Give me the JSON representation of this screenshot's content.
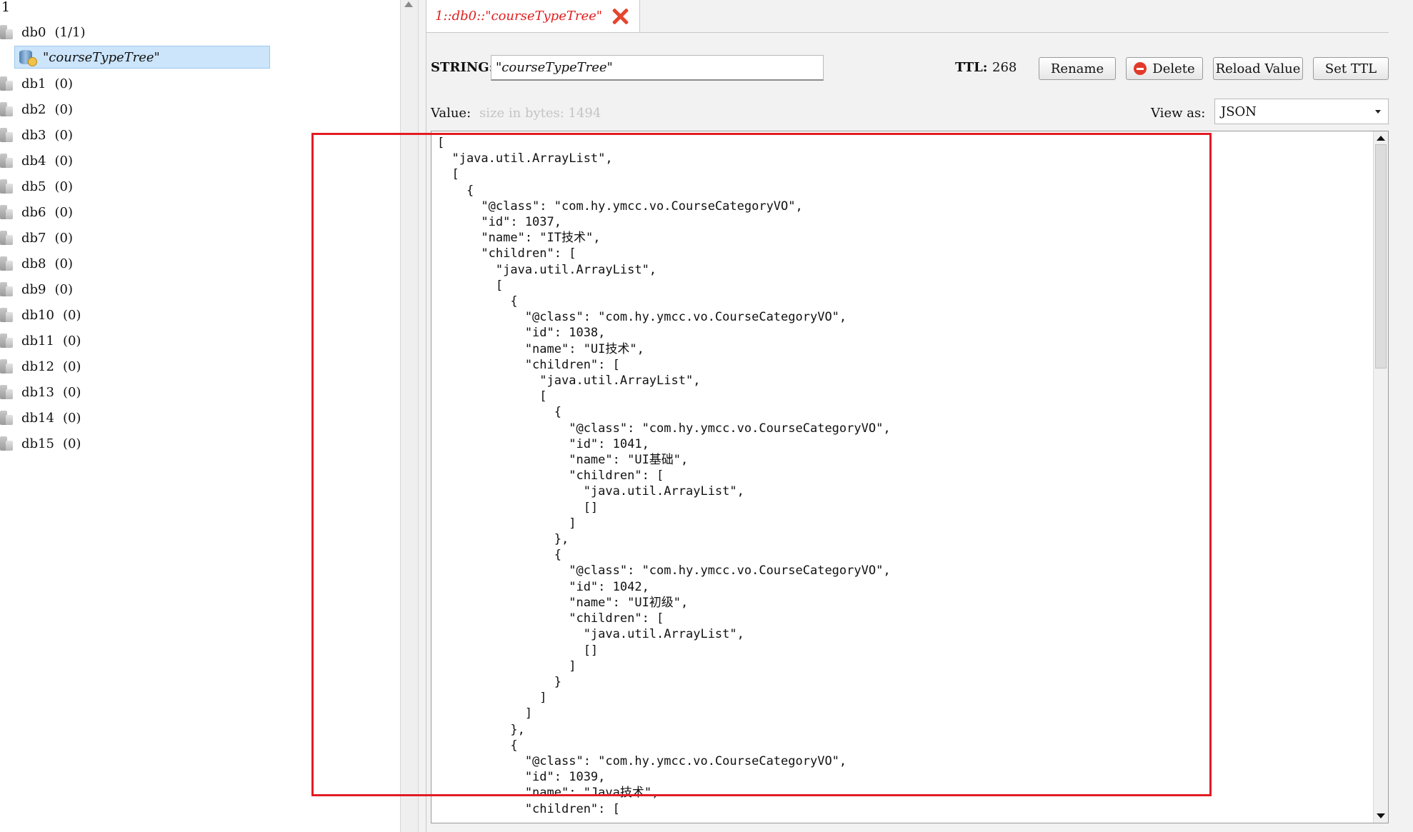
{
  "tree": {
    "root_label": "1",
    "databases": [
      {
        "name": "db0",
        "count": "(1/1)"
      },
      {
        "name": "db1",
        "count": "(0)"
      },
      {
        "name": "db2",
        "count": "(0)"
      },
      {
        "name": "db3",
        "count": "(0)"
      },
      {
        "name": "db4",
        "count": "(0)"
      },
      {
        "name": "db5",
        "count": "(0)"
      },
      {
        "name": "db6",
        "count": "(0)"
      },
      {
        "name": "db7",
        "count": "(0)"
      },
      {
        "name": "db8",
        "count": "(0)"
      },
      {
        "name": "db9",
        "count": "(0)"
      },
      {
        "name": "db10",
        "count": "(0)"
      },
      {
        "name": "db11",
        "count": "(0)"
      },
      {
        "name": "db12",
        "count": "(0)"
      },
      {
        "name": "db13",
        "count": "(0)"
      },
      {
        "name": "db14",
        "count": "(0)"
      },
      {
        "name": "db15",
        "count": "(0)"
      }
    ],
    "selected_key": "\"courseTypeTree\"",
    "icons": {
      "database": "database-icon",
      "key": "key-icon"
    }
  },
  "tab": {
    "label": "1::db0::\"courseTypeTree\"",
    "close_icon": "close-icon",
    "label_color": "#e02020"
  },
  "toolbar": {
    "type_label": "STRING:",
    "key_value": "\"courseTypeTree\"",
    "ttl_label": "TTL:",
    "ttl_value": "268",
    "rename_label": "Rename",
    "delete_label": "Delete",
    "reload_label": "Reload Value",
    "set_ttl_label": "Set TTL"
  },
  "value_bar": {
    "value_label": "Value:",
    "size_hint": "size in bytes: 1494",
    "view_as_label": "View as:",
    "view_as_selected": "JSON"
  },
  "editor": {
    "lines": [
      "[",
      "  \"java.util.ArrayList\",",
      "  [",
      "    {",
      "      \"@class\": \"com.hy.ymcc.vo.CourseCategoryVO\",",
      "      \"id\": 1037,",
      "      \"name\": \"IT技术\",",
      "      \"children\": [",
      "        \"java.util.ArrayList\",",
      "        [",
      "          {",
      "            \"@class\": \"com.hy.ymcc.vo.CourseCategoryVO\",",
      "            \"id\": 1038,",
      "            \"name\": \"UI技术\",",
      "            \"children\": [",
      "              \"java.util.ArrayList\",",
      "              [",
      "                {",
      "                  \"@class\": \"com.hy.ymcc.vo.CourseCategoryVO\",",
      "                  \"id\": 1041,",
      "                  \"name\": \"UI基础\",",
      "                  \"children\": [",
      "                    \"java.util.ArrayList\",",
      "                    []",
      "                  ]",
      "                },",
      "                {",
      "                  \"@class\": \"com.hy.ymcc.vo.CourseCategoryVO\",",
      "                  \"id\": 1042,",
      "                  \"name\": \"UI初级\",",
      "                  \"children\": [",
      "                    \"java.util.ArrayList\",",
      "                    []",
      "                  ]",
      "                }",
      "              ]",
      "            ]",
      "          },",
      "          {",
      "            \"@class\": \"com.hy.ymcc.vo.CourseCategoryVO\",",
      "            \"id\": 1039,",
      "            \"name\": \"Java技术\",",
      "            \"children\": ["
    ]
  },
  "annotation": {
    "color": "#e21c24"
  }
}
